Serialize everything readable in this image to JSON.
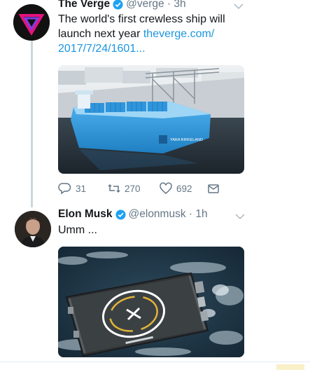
{
  "tweet1": {
    "author_name": "The Verge",
    "handle_time": "@verge · 3h",
    "text_line": "The world's first crewless ship will launch next year ",
    "link_text": "theverge.com/ 2017/7/24/1601...",
    "ship_label": "YARA BIRKELAND",
    "actions": {
      "replies": "31",
      "retweets": "270",
      "likes": "692"
    }
  },
  "tweet2": {
    "author_name": "Elon Musk",
    "handle_time": "@elonmusk · 1h",
    "text": "Umm ..."
  },
  "colors": {
    "link": "#1b95e0",
    "verified": "#1da1f2",
    "muted": "#657786",
    "verge_magenta": "#e5127d"
  }
}
